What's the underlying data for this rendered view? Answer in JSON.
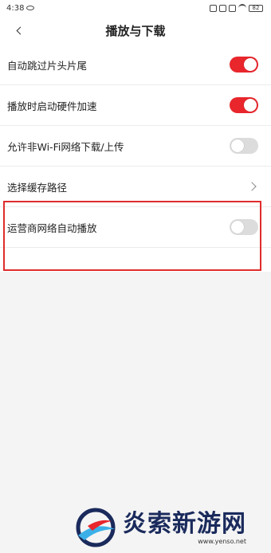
{
  "status_bar": {
    "time": "4:38",
    "battery": "82"
  },
  "header": {
    "title": "播放与下载"
  },
  "settings": [
    {
      "label": "自动跳过片头片尾",
      "control": "toggle",
      "state": "on"
    },
    {
      "label": "播放时启动硬件加速",
      "control": "toggle",
      "state": "on"
    },
    {
      "label": "允许非Wi-Fi网络下载/上传",
      "control": "toggle",
      "state": "off"
    },
    {
      "label": "选择缓存路径",
      "control": "chevron"
    },
    {
      "label": "运营商网络自动播放",
      "control": "toggle",
      "state": "off"
    }
  ],
  "watermark": {
    "text": "炎索新游网",
    "url": "www.yenso.net"
  },
  "colors": {
    "accent": "#e8262c",
    "highlight": "#e02c2c",
    "background": "#f4f4f4"
  }
}
